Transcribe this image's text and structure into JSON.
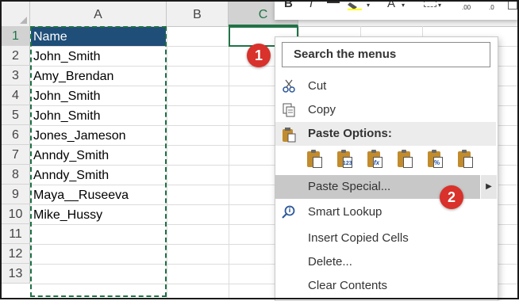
{
  "columns": [
    "A",
    "B",
    "C"
  ],
  "rows": [
    "1",
    "2",
    "3",
    "4",
    "5",
    "6",
    "7",
    "8",
    "9",
    "10",
    "11",
    "12",
    "13"
  ],
  "column_a_cells": [
    "Name",
    "John_Smith",
    "Amy_Brendan",
    "John_Smith",
    "John_Smith",
    "Jones_Jameson",
    "Anndy_Smith",
    "Anndy_Smith",
    "Maya__Ruseeva",
    "Mike_Hussy"
  ],
  "mini_toolbar": {
    "bold": "B",
    "italic": "I",
    "font_color": "A",
    "decimal_label": ".00",
    "decimal_label2": ".0"
  },
  "context_menu": {
    "search_placeholder": "Search the menus",
    "items": {
      "cut": "Cut",
      "copy": "Copy",
      "paste_options": "Paste Options:",
      "paste_special": "Paste Special...",
      "smart_lookup": "Smart Lookup",
      "insert_copied_cells": "Insert Copied Cells",
      "delete": "Delete...",
      "clear_contents": "Clear Contents"
    },
    "paste_option_labels": [
      "",
      "123",
      "fx",
      "",
      "%",
      ""
    ]
  },
  "callouts": [
    "1",
    "2"
  ],
  "colors": {
    "header_fill": "#1f4e78",
    "excel_green": "#217346",
    "callout_red": "#d9312b"
  }
}
